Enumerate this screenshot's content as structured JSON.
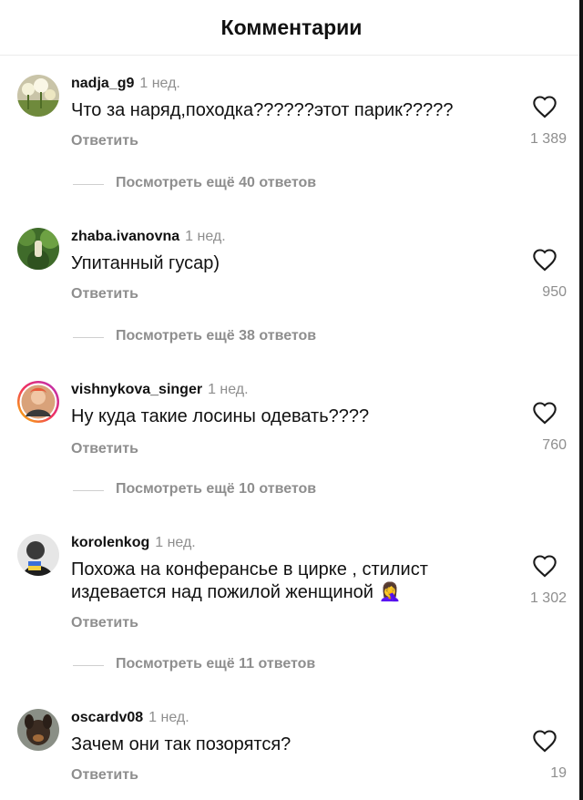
{
  "header": {
    "title": "Комментарии"
  },
  "colors": {
    "text": "#111111",
    "secondary": "#8e8e8e",
    "divider": "#ececec"
  },
  "comments": [
    {
      "username": "nadja_g9",
      "time": "1 нед.",
      "text": "Что за наряд,походка??????этот парик?????",
      "reply_label": "Ответить",
      "likes": "1 389",
      "view_more": "Посмотреть ещё 40 ответов",
      "avatar_icon": "avatar-flowers"
    },
    {
      "username": "zhaba.ivanovna",
      "time": "1 нед.",
      "text": "Упитанный гусар)",
      "reply_label": "Ответить",
      "likes": "950",
      "view_more": "Посмотреть ещё 38 ответов",
      "avatar_icon": "avatar-greenery"
    },
    {
      "username": "vishnykova_singer",
      "time": "1 нед.",
      "text": "Ну куда такие лосины одевать????",
      "reply_label": "Ответить",
      "likes": "760",
      "view_more": "Посмотреть ещё 10 ответов",
      "avatar_icon": "avatar-story-ring"
    },
    {
      "username": "korolenkog",
      "time": "1 нед.",
      "text": "Похожа на конферансье в цирке , стилист издевается над пожилой женщиной 🤦‍♀️",
      "reply_label": "Ответить",
      "likes": "1 302",
      "view_more": "Посмотреть ещё 11 ответов",
      "avatar_icon": "avatar-bw-flag"
    },
    {
      "username": "oscardv08",
      "time": "1 нед.",
      "text": "Зачем они так позорятся?",
      "reply_label": "Ответить",
      "likes": "19",
      "avatar_icon": "avatar-dog"
    }
  ]
}
